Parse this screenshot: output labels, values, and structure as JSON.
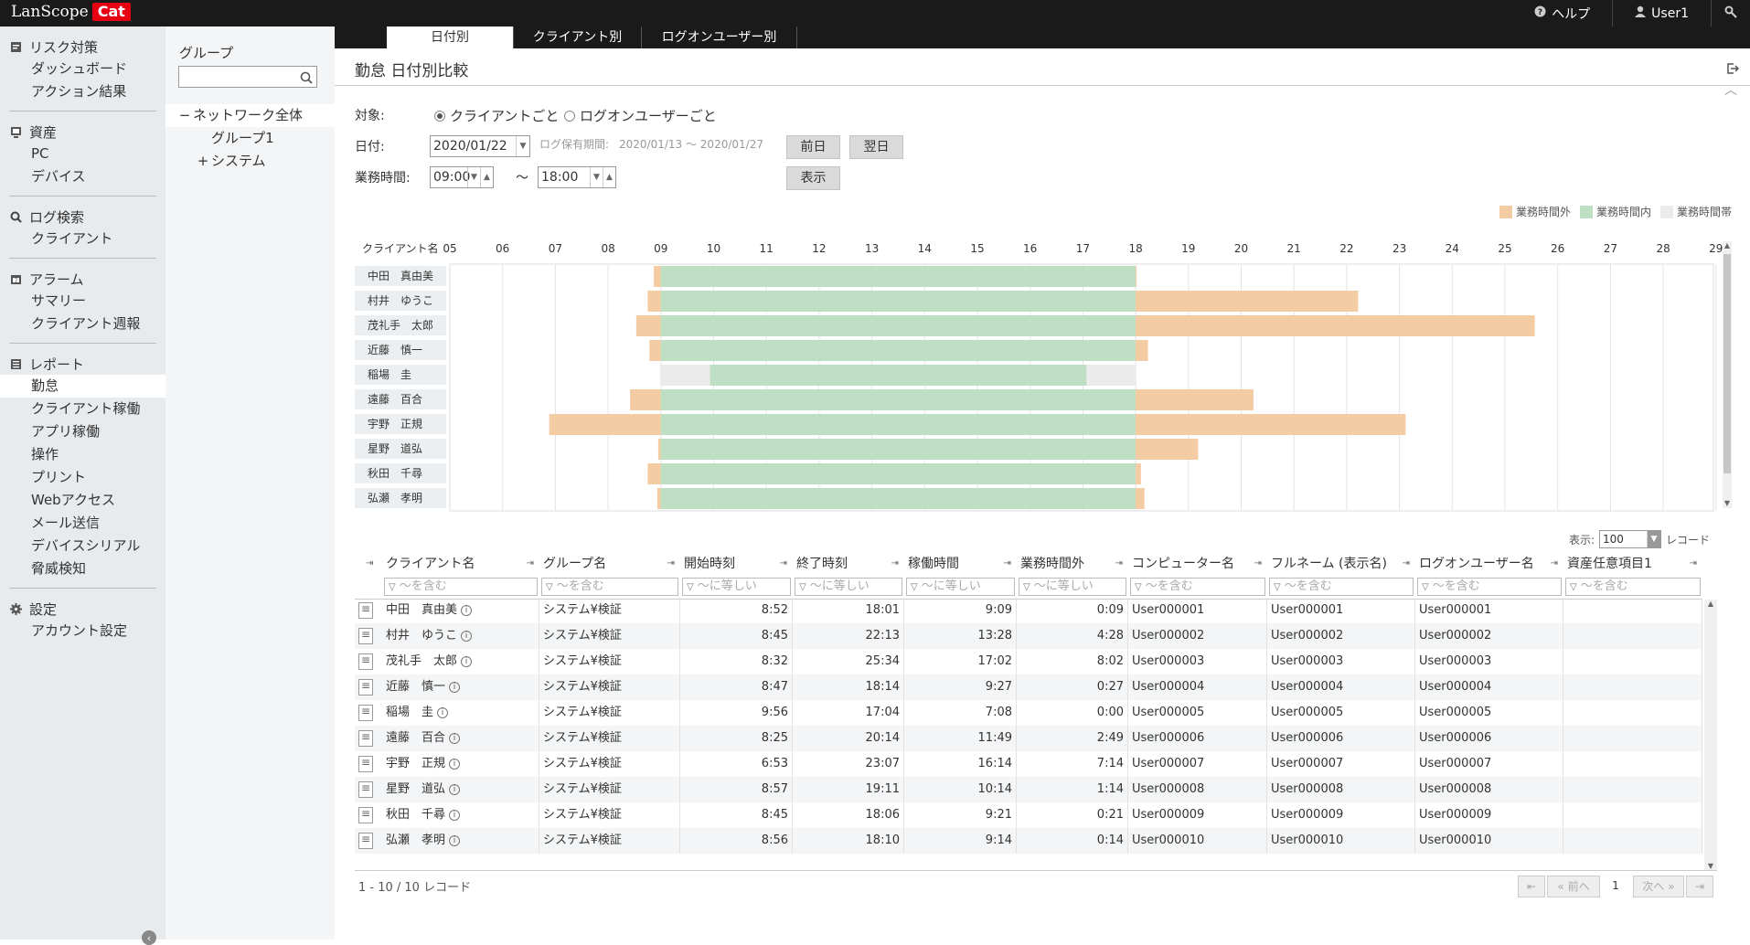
{
  "app": {
    "logo_text": "LanScope",
    "logo_badge": "Cat"
  },
  "topbar": {
    "help": "ヘルプ",
    "user": "User1"
  },
  "sidebar": {
    "groups": [
      {
        "label": "リスク対策",
        "icon": "clipboard-icon",
        "items": [
          "ダッシュボード",
          "アクション結果"
        ]
      },
      {
        "label": "資産",
        "icon": "monitor-icon",
        "items": [
          "PC",
          "デバイス"
        ]
      },
      {
        "label": "ログ検索",
        "icon": "search-icon",
        "items": [
          "クライアント"
        ]
      },
      {
        "label": "アラーム",
        "icon": "calendar-icon",
        "items": [
          "サマリー",
          "クライアント週報"
        ]
      },
      {
        "label": "レポート",
        "icon": "report-icon",
        "items": [
          "勤怠",
          "クライアント稼働",
          "アプリ稼働",
          "操作",
          "プリント",
          "Webアクセス",
          "メール送信",
          "デバイスシリアル",
          "脅威検知"
        ]
      },
      {
        "label": "設定",
        "icon": "gear-icon",
        "items": [
          "アカウント設定"
        ]
      }
    ]
  },
  "grouppanel": {
    "title": "グループ",
    "search_value": "",
    "tree": [
      {
        "label": "ネットワーク全体",
        "prefix": "−"
      },
      {
        "label": "グループ1",
        "prefix": ""
      },
      {
        "label": "システム",
        "prefix": "+"
      }
    ]
  },
  "tabs": [
    "日付別",
    "クライアント別",
    "ログオンユーザー別"
  ],
  "page": {
    "title": "勤怠 日付別比較"
  },
  "form": {
    "target_label": "対象:",
    "radio_client": "クライアントごと",
    "radio_user": "ログオンユーザーごと",
    "date_label": "日付:",
    "date_value": "2020/01/22",
    "log_period_label": "ログ保有期間:",
    "log_period_value": "2020/01/13 ～ 2020/01/27",
    "prev_button": "前日",
    "next_button": "翌日",
    "hours_label": "業務時間:",
    "start_time": "09:00",
    "tilde": "～",
    "end_time": "18:00",
    "show_button": "表示"
  },
  "legend": {
    "outside": "業務時間外",
    "inside": "業務時間内",
    "band": "業務時間帯",
    "colors": {
      "outside": "#f4cca4",
      "inside": "#bfdfc5",
      "band": "#ebebeb"
    }
  },
  "chart_data": {
    "type": "bar",
    "row_header": "クライアント名",
    "hours": [
      "05",
      "06",
      "07",
      "08",
      "09",
      "10",
      "11",
      "12",
      "13",
      "14",
      "15",
      "16",
      "17",
      "18",
      "19",
      "20",
      "21",
      "22",
      "23",
      "24",
      "25",
      "26",
      "27",
      "28",
      "29"
    ],
    "business_hours": [
      9,
      18
    ],
    "rows": [
      {
        "name": "中田　真由美",
        "start": "8:52",
        "end": "18:01"
      },
      {
        "name": "村井　ゆうこ",
        "start": "8:45",
        "end": "22:13"
      },
      {
        "name": "茂礼手　太郎",
        "start": "8:32",
        "end": "25:34"
      },
      {
        "name": "近藤　慎一",
        "start": "8:47",
        "end": "18:14"
      },
      {
        "name": "稲場　圭",
        "start": "9:56",
        "end": "17:04"
      },
      {
        "name": "遠藤　百合",
        "start": "8:25",
        "end": "20:14"
      },
      {
        "name": "宇野　正規",
        "start": "6:53",
        "end": "23:07"
      },
      {
        "name": "星野　道弘",
        "start": "8:57",
        "end": "19:11"
      },
      {
        "name": "秋田　千尋",
        "start": "8:45",
        "end": "18:06"
      },
      {
        "name": "弘瀬　孝明",
        "start": "8:56",
        "end": "18:10"
      }
    ]
  },
  "table": {
    "display_label": "表示:",
    "page_size": "100",
    "records_label": "レコード",
    "columns": [
      "クライアント名",
      "グループ名",
      "開始時刻",
      "終了時刻",
      "稼働時間",
      "業務時間外",
      "コンピューター名",
      "フルネーム (表示名)",
      "ログオンユーザー名",
      "資産任意項目1"
    ],
    "filters": [
      "～を含む",
      "～を含む",
      "～に等しい",
      "～に等しい",
      "～に等しい",
      "～に等しい",
      "～を含む",
      "～を含む",
      "～を含む",
      "～を含む"
    ],
    "rows": [
      [
        "中田　真由美",
        "システム¥検証",
        "8:52",
        "18:01",
        "9:09",
        "0:09",
        "User000001",
        "User000001",
        "User000001",
        ""
      ],
      [
        "村井　ゆうこ",
        "システム¥検証",
        "8:45",
        "22:13",
        "13:28",
        "4:28",
        "User000002",
        "User000002",
        "User000002",
        ""
      ],
      [
        "茂礼手　太郎",
        "システム¥検証",
        "8:32",
        "25:34",
        "17:02",
        "8:02",
        "User000003",
        "User000003",
        "User000003",
        ""
      ],
      [
        "近藤　慎一",
        "システム¥検証",
        "8:47",
        "18:14",
        "9:27",
        "0:27",
        "User000004",
        "User000004",
        "User000004",
        ""
      ],
      [
        "稲場　圭",
        "システム¥検証",
        "9:56",
        "17:04",
        "7:08",
        "0:00",
        "User000005",
        "User000005",
        "User000005",
        ""
      ],
      [
        "遠藤　百合",
        "システム¥検証",
        "8:25",
        "20:14",
        "11:49",
        "2:49",
        "User000006",
        "User000006",
        "User000006",
        ""
      ],
      [
        "宇野　正規",
        "システム¥検証",
        "6:53",
        "23:07",
        "16:14",
        "7:14",
        "User000007",
        "User000007",
        "User000007",
        ""
      ],
      [
        "星野　道弘",
        "システム¥検証",
        "8:57",
        "19:11",
        "10:14",
        "1:14",
        "User000008",
        "User000008",
        "User000008",
        ""
      ],
      [
        "秋田　千尋",
        "システム¥検証",
        "8:45",
        "18:06",
        "9:21",
        "0:21",
        "User000009",
        "User000009",
        "User000009",
        ""
      ],
      [
        "弘瀬　孝明",
        "システム¥検証",
        "8:56",
        "18:10",
        "9:14",
        "0:14",
        "User000010",
        "User000010",
        "User000010",
        ""
      ]
    ],
    "footer": "1 - 10 / 10 レコード",
    "pager": {
      "first": "⇤",
      "prev": "« 前へ",
      "page": "1",
      "next": "次へ »",
      "last": "⇥"
    }
  }
}
